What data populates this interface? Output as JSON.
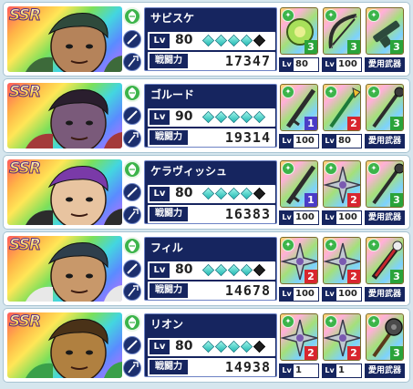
{
  "labels": {
    "rarity": "SSR",
    "level": "Lv",
    "power": "戦闘力",
    "weapon_level": "Lv",
    "favorite_weapon": "愛用武器"
  },
  "colors": {
    "panel": "#16255f",
    "gem": "#1fb8b2",
    "element_green": "#3cb44a",
    "slot1": "#4a3cc6",
    "slot2": "#d8262e",
    "slot3": "#2aa33a"
  },
  "characters": [
    {
      "name": "サビスケ",
      "level": "80",
      "stars_filled": 4,
      "stars_total": 5,
      "power": "17347",
      "weapons": [
        {
          "icon": "shield-icon",
          "slot": "3",
          "level": "80"
        },
        {
          "icon": "bow-icon",
          "slot": "3",
          "level": "100"
        },
        {
          "icon": "gun-icon",
          "slot": "3",
          "level": ""
        }
      ]
    },
    {
      "name": "ゴルード",
      "level": "90",
      "stars_filled": 5,
      "stars_total": 5,
      "power": "19314",
      "weapons": [
        {
          "icon": "sword-icon",
          "slot": "1",
          "level": "100"
        },
        {
          "icon": "spear-icon",
          "slot": "2",
          "level": "80"
        },
        {
          "icon": "staff-icon",
          "slot": "3",
          "level": ""
        }
      ]
    },
    {
      "name": "ケラヴィッシュ",
      "level": "80",
      "stars_filled": 4,
      "stars_total": 5,
      "power": "16383",
      "weapons": [
        {
          "icon": "sword-icon",
          "slot": "1",
          "level": "100"
        },
        {
          "icon": "shuriken-icon",
          "slot": "2",
          "level": "100"
        },
        {
          "icon": "staff-icon",
          "slot": "3",
          "level": ""
        }
      ]
    },
    {
      "name": "フィル",
      "level": "80",
      "stars_filled": 4,
      "stars_total": 5,
      "power": "14678",
      "weapons": [
        {
          "icon": "shuriken-icon",
          "slot": "2",
          "level": "100"
        },
        {
          "icon": "shuriken-icon",
          "slot": "2",
          "level": "100"
        },
        {
          "icon": "bone-icon",
          "slot": "3",
          "level": ""
        }
      ]
    },
    {
      "name": "リオン",
      "level": "80",
      "stars_filled": 4,
      "stars_total": 5,
      "power": "14938",
      "weapons": [
        {
          "icon": "shuriken-icon",
          "slot": "2",
          "level": "1"
        },
        {
          "icon": "shuriken-icon",
          "slot": "2",
          "level": "1"
        },
        {
          "icon": "mace-icon",
          "slot": "3",
          "level": ""
        }
      ]
    }
  ]
}
